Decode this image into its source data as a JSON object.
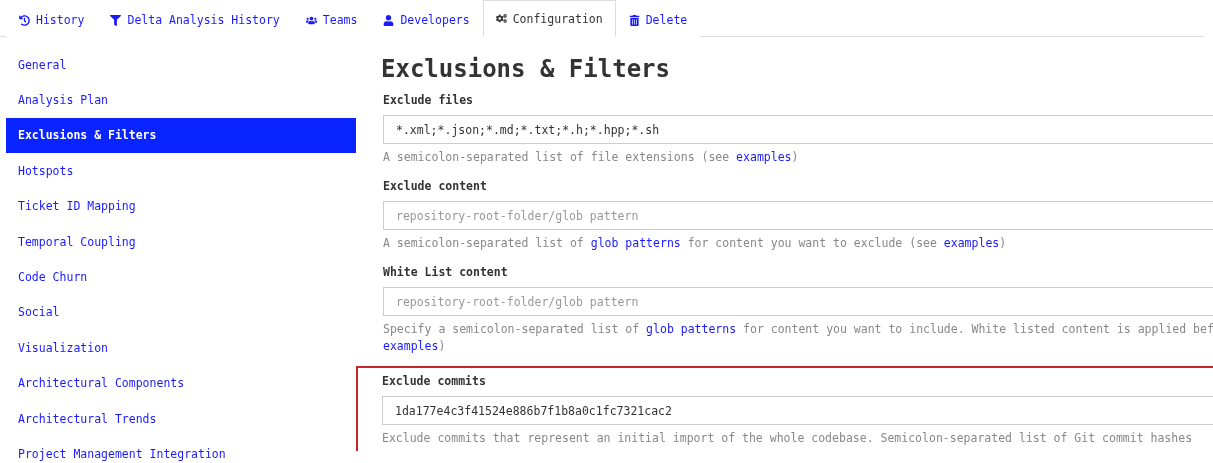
{
  "tabs": [
    {
      "label": "History",
      "selected": false
    },
    {
      "label": "Delta Analysis History",
      "selected": false
    },
    {
      "label": "Teams",
      "selected": false
    },
    {
      "label": "Developers",
      "selected": false
    },
    {
      "label": "Configuration",
      "selected": true
    },
    {
      "label": "Delete",
      "selected": false
    }
  ],
  "sidebar": {
    "items": [
      {
        "label": "General",
        "selected": false
      },
      {
        "label": "Analysis Plan",
        "selected": false
      },
      {
        "label": "Exclusions & Filters",
        "selected": true
      },
      {
        "label": "Hotspots",
        "selected": false
      },
      {
        "label": "Ticket ID Mapping",
        "selected": false
      },
      {
        "label": "Temporal Coupling",
        "selected": false
      },
      {
        "label": "Code Churn",
        "selected": false
      },
      {
        "label": "Social",
        "selected": false
      },
      {
        "label": "Visualization",
        "selected": false
      },
      {
        "label": "Architectural Components",
        "selected": false
      },
      {
        "label": "Architectural Trends",
        "selected": false
      },
      {
        "label": "Project Management Integration",
        "selected": false
      }
    ]
  },
  "heading": "Exclusions & Filters",
  "fields": [
    {
      "label": "Exclude files",
      "value": "*.xml;*.json;*.md;*.txt;*.h;*.hpp;*.sh",
      "highlighted": false,
      "help": [
        [
          {
            "kind": "text",
            "text": "A semicolon-separated list of file extensions (see "
          },
          {
            "kind": "link",
            "text": "examples"
          },
          {
            "kind": "text",
            "text": ")"
          }
        ]
      ]
    },
    {
      "label": "Exclude content",
      "placeholder": "repository-root-folder/glob pattern",
      "highlighted": false,
      "help": [
        [
          {
            "kind": "text",
            "text": "A semicolon-separated list of "
          },
          {
            "kind": "link",
            "text": "glob patterns"
          },
          {
            "kind": "text",
            "text": " for content you want to exclude (see "
          },
          {
            "kind": "link",
            "text": "examples"
          },
          {
            "kind": "text",
            "text": ")"
          }
        ]
      ]
    },
    {
      "label": "White List content",
      "placeholder": "repository-root-folder/glob pattern",
      "highlighted": false,
      "help": [
        [
          {
            "kind": "text",
            "text": "Specify a semicolon-separated list of "
          },
          {
            "kind": "link",
            "text": "glob patterns"
          },
          {
            "kind": "text",
            "text": " for content you want to include. White listed content is applied bef"
          }
        ],
        [
          {
            "kind": "link",
            "text": "examples"
          },
          {
            "kind": "text",
            "text": ")"
          }
        ]
      ]
    },
    {
      "label": "Exclude commits",
      "value": "1da177e4c3f41524e886b7f1b8a0c1fc7321cac2",
      "highlighted": true,
      "help": [
        [
          {
            "kind": "text",
            "text": "Exclude commits that represent an initial import of the whole codebase. Semicolon-separated list of Git commit hashes"
          }
        ]
      ]
    }
  ]
}
